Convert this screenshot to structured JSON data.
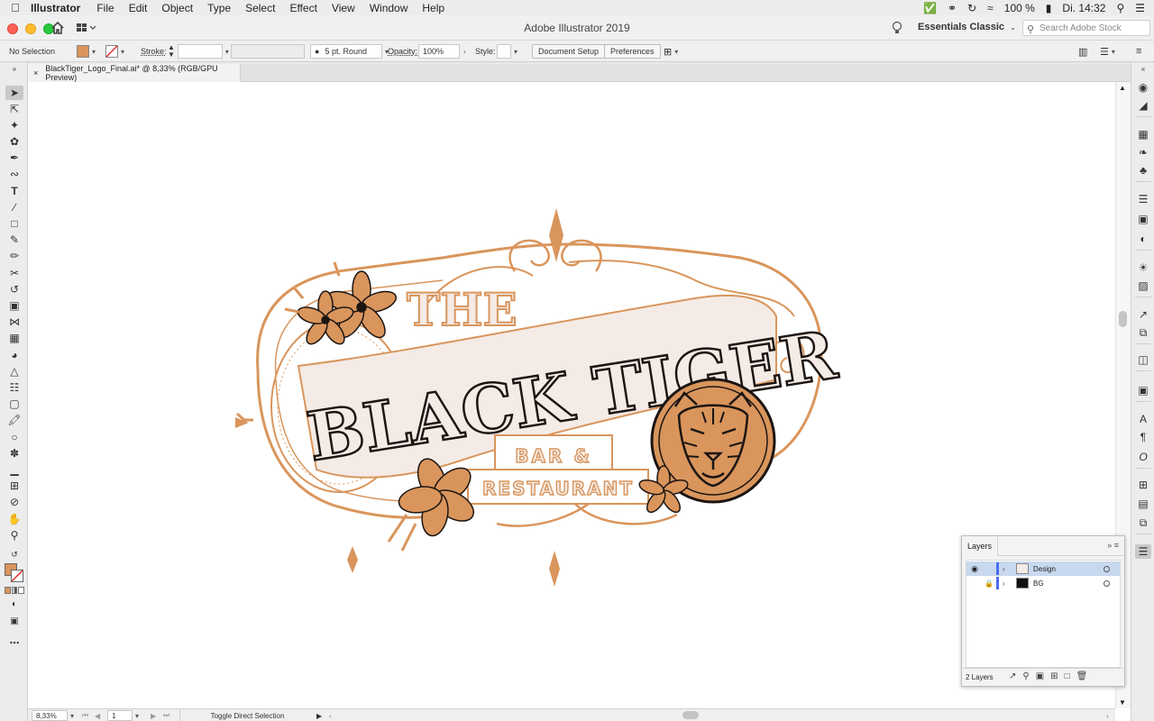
{
  "menubar": {
    "app_name": "Illustrator",
    "items": [
      "File",
      "Edit",
      "Object",
      "Type",
      "Select",
      "Effect",
      "View",
      "Window",
      "Help"
    ],
    "battery": "100 %",
    "clock": "Di. 14:32"
  },
  "titlebar": {
    "title": "Adobe Illustrator 2019",
    "workspace": "Essentials Classic",
    "search_placeholder": "Search Adobe Stock"
  },
  "control_bar": {
    "selection": "No Selection",
    "fill_color": "#d9955c",
    "stroke_label": "Stroke:",
    "brush": "5 pt. Round",
    "opacity_label": "Opacity:",
    "opacity_value": "100%",
    "style_label": "Style:",
    "document_setup": "Document Setup",
    "preferences": "Preferences"
  },
  "document": {
    "tab_title": "BlackTiger_Logo_Final.ai* @ 8,33% (RGB/GPU Preview)",
    "close": "×"
  },
  "artwork": {
    "line1": "THE",
    "line2": "BLACK TIGER",
    "line3": "BAR &",
    "line4": "RESTAURANT",
    "accent_color": "#d9955c",
    "ink_color": "#1c1512",
    "cream_color": "#f4ebe6"
  },
  "status": {
    "zoom": "8,33%",
    "artboard": "1",
    "tool_hint": "Toggle Direct Selection"
  },
  "layers_panel": {
    "title": "Layers",
    "layers": [
      {
        "name": "Design",
        "color": "#4a6ef0",
        "selected": true,
        "visible": true,
        "locked": false
      },
      {
        "name": "BG",
        "color": "#4a6ef0",
        "selected": false,
        "visible": false,
        "locked": true
      }
    ],
    "count": "2 Layers"
  }
}
